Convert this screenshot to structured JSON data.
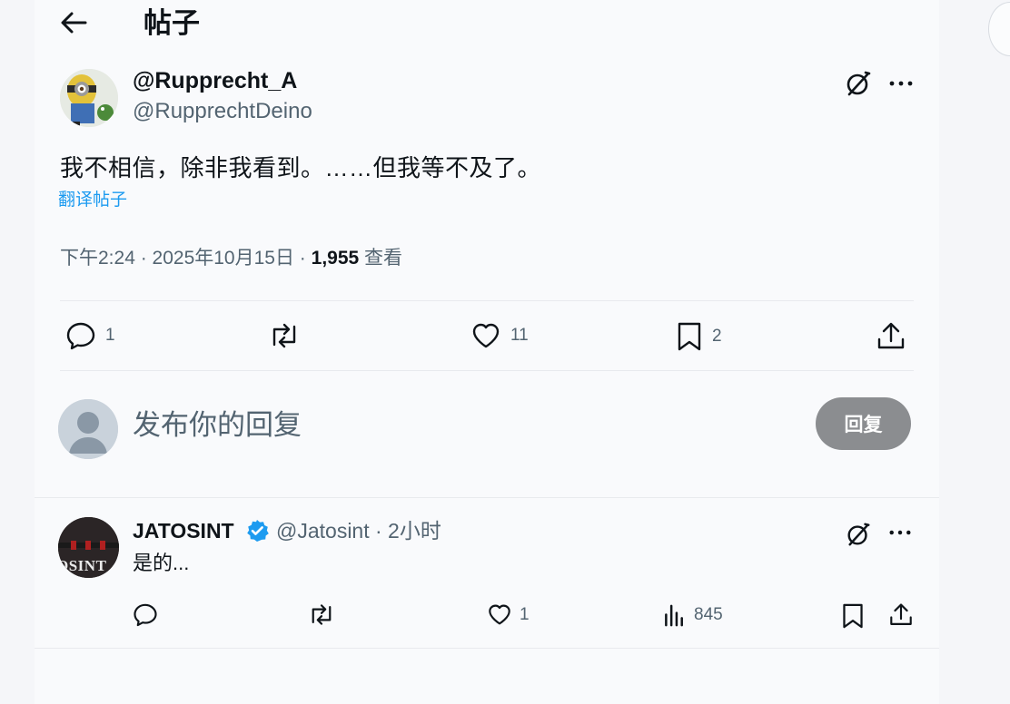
{
  "header": {
    "title": "帖子",
    "back_icon": "arrow-left-icon"
  },
  "post": {
    "display_name": "@Rupprecht_A",
    "handle": "@RupprechtDeino",
    "text": "我不相信，除非我看到。……但我等不及了。",
    "translate_label": "翻译帖子",
    "time": "下午2:24 · 2025年10月15日 · ",
    "views_count": "1,955",
    "views_label": " 查看",
    "actions": {
      "reply_count": "1",
      "repost_count": "",
      "like_count": "11",
      "bookmark_count": "2"
    }
  },
  "composer": {
    "placeholder": "发布你的回复",
    "button_label": "回复",
    "button_color": "#8b8d90"
  },
  "comment": {
    "display_name": "JATOSINT",
    "handle_time": "@Jatosint · 2小时",
    "text": "是的...",
    "avatar_text": "OSINT",
    "actions": {
      "reply_count": "",
      "repost_count": "",
      "like_count": "1",
      "views_count": "845"
    }
  },
  "colors": {
    "accent": "#1d9bf0",
    "text_primary": "#0f1419",
    "text_secondary": "#536471",
    "background": "#f9fafc"
  }
}
